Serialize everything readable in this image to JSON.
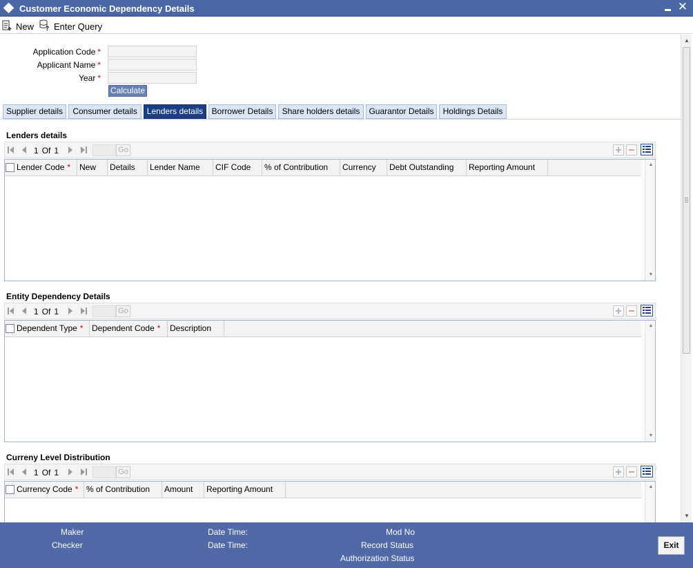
{
  "window": {
    "title": "Customer Economic Dependency Details",
    "minimize_icon": "minimize-icon",
    "close_label": "✕"
  },
  "toolbar": {
    "new_label": "New",
    "enter_query_label": "Enter Query"
  },
  "form": {
    "application_code_label": "Application Code",
    "applicant_name_label": "Applicant Name",
    "year_label": "Year",
    "required_mark": "*",
    "application_code_value": "",
    "applicant_name_value": "",
    "year_value": "",
    "calculate_label": "Calculate"
  },
  "tabs": [
    {
      "label": "Supplier details"
    },
    {
      "label": "Consumer details"
    },
    {
      "label": "Lenders details",
      "active": true
    },
    {
      "label": "Borrower Details"
    },
    {
      "label": "Share holders details"
    },
    {
      "label": "Guarantor Details"
    },
    {
      "label": "Holdings Details"
    }
  ],
  "sections": {
    "lenders": {
      "title": "Lenders details",
      "page_current": "1",
      "page_of": "Of",
      "page_total": "1",
      "go_label": "Go",
      "columns": [
        "Lender Code",
        "New",
        "Details",
        "Lender Name",
        "CIF Code",
        "% of Contribution",
        "Currency",
        "Debt Outstanding",
        "Reporting Amount"
      ]
    },
    "entity": {
      "title": "Entity Dependency Details",
      "page_current": "1",
      "page_of": "Of",
      "page_total": "1",
      "go_label": "Go",
      "columns": [
        "Dependent Type",
        "Dependent Code",
        "Description"
      ]
    },
    "currency": {
      "title": "Curreny Level Distribution",
      "page_current": "1",
      "page_of": "Of",
      "page_total": "1",
      "go_label": "Go",
      "columns": [
        "Currency Code",
        "% of Contribution",
        "Amount",
        "Reporting Amount"
      ]
    }
  },
  "footer": {
    "maker_label": "Maker",
    "checker_label": "Checker",
    "date_time_label_1": "Date Time:",
    "date_time_label_2": "Date Time:",
    "mod_no_label": "Mod No",
    "record_status_label": "Record Status",
    "authorization_status_label": "Authorization Status",
    "exit_label": "Exit"
  },
  "colors": {
    "title_bar": "#4a68a6",
    "active_tab": "#1c3e84",
    "footer": "#4f6aa7",
    "required": "#cc0000"
  }
}
